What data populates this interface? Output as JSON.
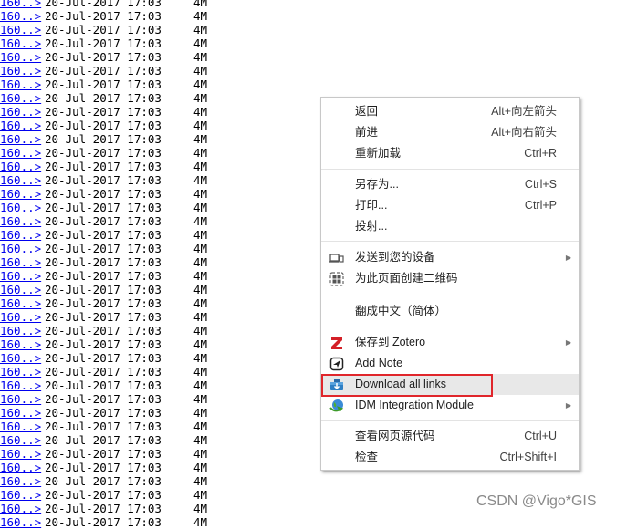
{
  "listing": {
    "row_count": 39,
    "link_text": "160..>",
    "date": "20-Jul-2017 17:03",
    "size": "4M"
  },
  "context_menu": {
    "items": [
      {
        "label": "返回",
        "shortcut": "Alt+向左箭头"
      },
      {
        "label": "前进",
        "shortcut": "Alt+向右箭头"
      },
      {
        "label": "重新加载",
        "shortcut": "Ctrl+R"
      },
      {
        "label": "另存为...",
        "shortcut": "Ctrl+S"
      },
      {
        "label": "打印...",
        "shortcut": "Ctrl+P"
      },
      {
        "label": "投射...",
        "shortcut": ""
      },
      {
        "label": "发送到您的设备",
        "icon": "devices-icon",
        "submenu": true
      },
      {
        "label": "为此页面创建二维码",
        "icon": "qr-code-icon"
      },
      {
        "label": "翻成中文（简体）"
      },
      {
        "label": "保存到 Zotero",
        "icon": "zotero-icon",
        "submenu": true
      },
      {
        "label": "Add Note",
        "icon": "add-note-icon"
      },
      {
        "label": "Download all links",
        "icon": "download-toolbox-icon",
        "highlighted": true
      },
      {
        "label": "IDM Integration Module",
        "icon": "idm-globe-icon",
        "submenu": true
      },
      {
        "label": "查看网页源代码",
        "shortcut": "Ctrl+U"
      },
      {
        "label": "检查",
        "shortcut": "Ctrl+Shift+I"
      }
    ],
    "highlight_color": "#e0262b"
  },
  "watermark": "CSDN @Vigo*GIS"
}
